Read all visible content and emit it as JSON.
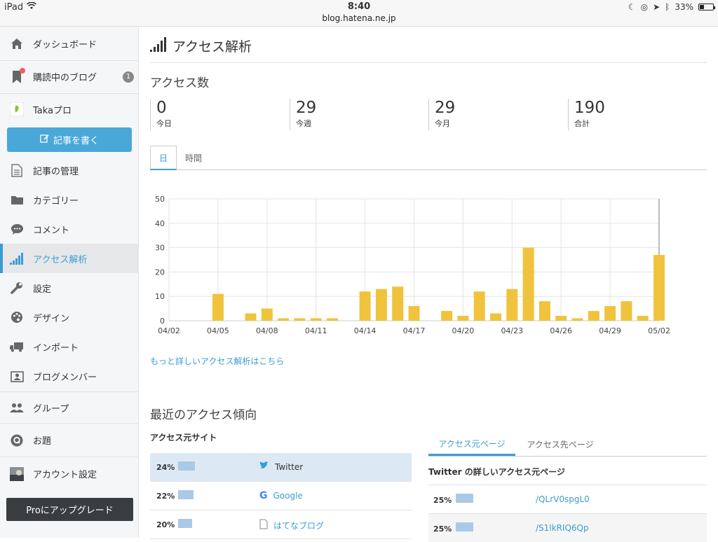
{
  "status_bar": {
    "device": "iPad",
    "time": "8:40",
    "url": "blog.hatena.ne.jp",
    "battery": "33%"
  },
  "sidebar": {
    "items": [
      {
        "label": "ダッシュボード",
        "icon": "home-icon"
      },
      {
        "label": "購読中のブログ",
        "icon": "bookmark-icon",
        "badge": "1"
      },
      {
        "label": "Takaプロ",
        "icon": "blog-avatar-icon"
      },
      {
        "label": "記事の管理",
        "icon": "document-icon"
      },
      {
        "label": "カテゴリー",
        "icon": "folder-icon"
      },
      {
        "label": "コメント",
        "icon": "comment-icon"
      },
      {
        "label": "アクセス解析",
        "icon": "signal-bars-icon"
      },
      {
        "label": "設定",
        "icon": "wrench-icon"
      },
      {
        "label": "デザイン",
        "icon": "palette-icon"
      },
      {
        "label": "インポート",
        "icon": "truck-icon"
      },
      {
        "label": "ブログメンバー",
        "icon": "members-icon"
      },
      {
        "label": "グループ",
        "icon": "group-icon"
      },
      {
        "label": "お題",
        "icon": "q-icon"
      },
      {
        "label": "アカウント設定",
        "icon": "account-avatar-icon"
      }
    ],
    "write_button": "記事を書く",
    "pro_button": "Proにアップグレード"
  },
  "page": {
    "title": "アクセス解析",
    "access_title": "アクセス数",
    "stats": [
      {
        "value": "0",
        "label": "今日"
      },
      {
        "value": "29",
        "label": "今週"
      },
      {
        "value": "29",
        "label": "今月"
      },
      {
        "value": "190",
        "label": "合計"
      }
    ],
    "tabs": [
      "日",
      "時間"
    ],
    "more_link": "もっと詳しいアクセス解析はこちら",
    "recent_title": "最近のアクセス傾向",
    "referrer_title": "アクセス元サイト",
    "referrers": [
      {
        "pct": "24%",
        "share": 24,
        "name": "Twitter",
        "icon": "twitter-icon"
      },
      {
        "pct": "22%",
        "share": 22,
        "name": "Google",
        "icon": "google-icon"
      },
      {
        "pct": "20%",
        "share": 20,
        "name": "はてなブログ",
        "icon": "page-icon"
      }
    ],
    "detail_tabs": [
      "アクセス元ページ",
      "アクセス先ページ"
    ],
    "detail_title": "Twitter の詳しいアクセス元ページ",
    "detail_rows": [
      {
        "pct": "25%",
        "share": 25,
        "path": "/QLrV0spgL0"
      },
      {
        "pct": "25%",
        "share": 25,
        "path": "/S1lkRIQ6Qp"
      }
    ]
  },
  "colors": {
    "accent": "#3b9dd4",
    "bar": "#f0c33c",
    "share_bar": "#aac9e6"
  },
  "chart_data": {
    "type": "bar",
    "x": [
      "04/02",
      "04/03",
      "04/04",
      "04/05",
      "04/06",
      "04/07",
      "04/08",
      "04/09",
      "04/10",
      "04/11",
      "04/12",
      "04/13",
      "04/14",
      "04/15",
      "04/16",
      "04/17",
      "04/18",
      "04/19",
      "04/20",
      "04/21",
      "04/22",
      "04/23",
      "04/24",
      "04/25",
      "04/26",
      "04/27",
      "04/28",
      "04/29",
      "04/30",
      "05/01",
      "05/02"
    ],
    "values": [
      0,
      0,
      0,
      11,
      0,
      3,
      5,
      1,
      1,
      1,
      1,
      0,
      12,
      13,
      14,
      6,
      0,
      4,
      2,
      12,
      3,
      13,
      30,
      8,
      2,
      1,
      4,
      6,
      8,
      2,
      27
    ],
    "tick_labels": [
      "04/02",
      "04/05",
      "04/08",
      "04/11",
      "04/14",
      "04/17",
      "04/20",
      "04/23",
      "04/26",
      "04/29",
      "05/02"
    ],
    "yticks": [
      0,
      10,
      20,
      30,
      40,
      50
    ],
    "ylim": [
      0,
      50
    ],
    "title": "",
    "xlabel": "",
    "ylabel": "",
    "grid": true
  }
}
